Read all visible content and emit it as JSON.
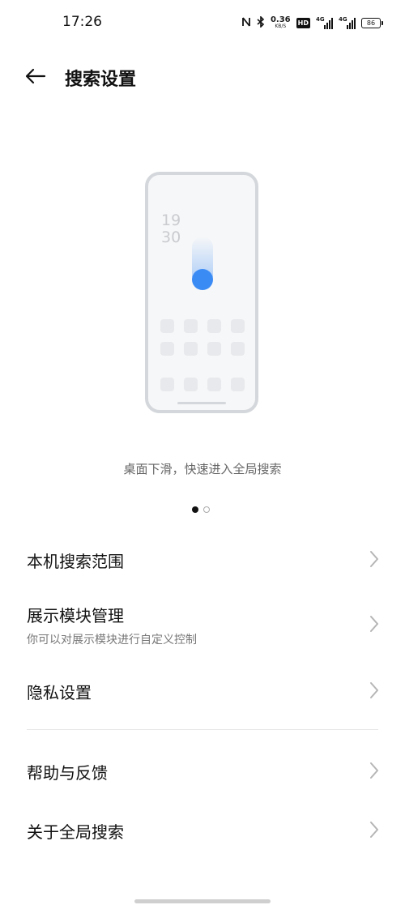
{
  "status_bar": {
    "time": "17:26",
    "net_speed_value": "0.36",
    "net_speed_unit": "KB/S",
    "hd_badge": "HD",
    "signal_tag": "4G",
    "battery_level": "86",
    "icons": [
      "nfc-icon",
      "bluetooth-icon",
      "hd-icon",
      "signal-icon",
      "signal-icon",
      "battery-icon"
    ]
  },
  "header": {
    "title": "搜索设置",
    "back_icon": "arrow-left-icon"
  },
  "illustration": {
    "clock_hour": "19",
    "clock_minute": "30",
    "accent": "#3b8bf5"
  },
  "carousel": {
    "caption": "桌面下滑，快速进入全局搜索",
    "page_count": 2,
    "active_index": 0
  },
  "settings": {
    "items": [
      {
        "title": "本机搜索范围",
        "subtitle": ""
      },
      {
        "title": "展示模块管理",
        "subtitle": "你可以对展示模块进行自定义控制"
      },
      {
        "title": "隐私设置",
        "subtitle": ""
      },
      {
        "title": "帮助与反馈",
        "subtitle": ""
      },
      {
        "title": "关于全局搜索",
        "subtitle": ""
      }
    ]
  }
}
